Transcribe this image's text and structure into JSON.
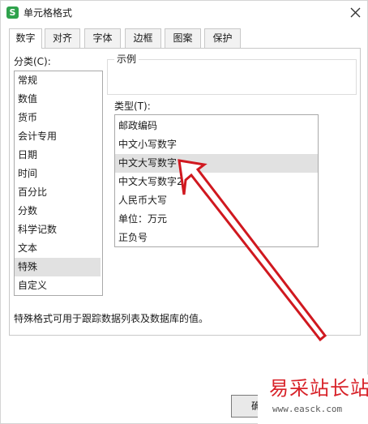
{
  "dialog": {
    "title": "单元格格式",
    "app_icon_letter": "S"
  },
  "tabs": [
    {
      "label": "数字",
      "active": true
    },
    {
      "label": "对齐",
      "active": false
    },
    {
      "label": "字体",
      "active": false
    },
    {
      "label": "边框",
      "active": false
    },
    {
      "label": "图案",
      "active": false
    },
    {
      "label": "保护",
      "active": false
    }
  ],
  "category": {
    "label": "分类(C):",
    "selected": "特殊",
    "items": [
      "常规",
      "数值",
      "货币",
      "会计专用",
      "日期",
      "时间",
      "百分比",
      "分数",
      "科学记数",
      "文本",
      "特殊",
      "自定义"
    ]
  },
  "sample": {
    "label": "示例",
    "value": ""
  },
  "type": {
    "label": "类型(T):",
    "selected": "中文大写数字",
    "items": [
      "邮政编码",
      "中文小写数字",
      "中文大写数字",
      "中文大写数字2",
      "人民币大写",
      "单位：万元",
      "正负号"
    ]
  },
  "description": "特殊格式可用于跟踪数据列表及数据库的值。",
  "buttons": {
    "ok_label": "确"
  },
  "watermark": {
    "text": "易采站长站",
    "url": "www.easck.com"
  },
  "colors": {
    "annotation_arrow": "#d0181f",
    "app_icon": "#2fa24c",
    "selection": "#e1e1e1"
  }
}
